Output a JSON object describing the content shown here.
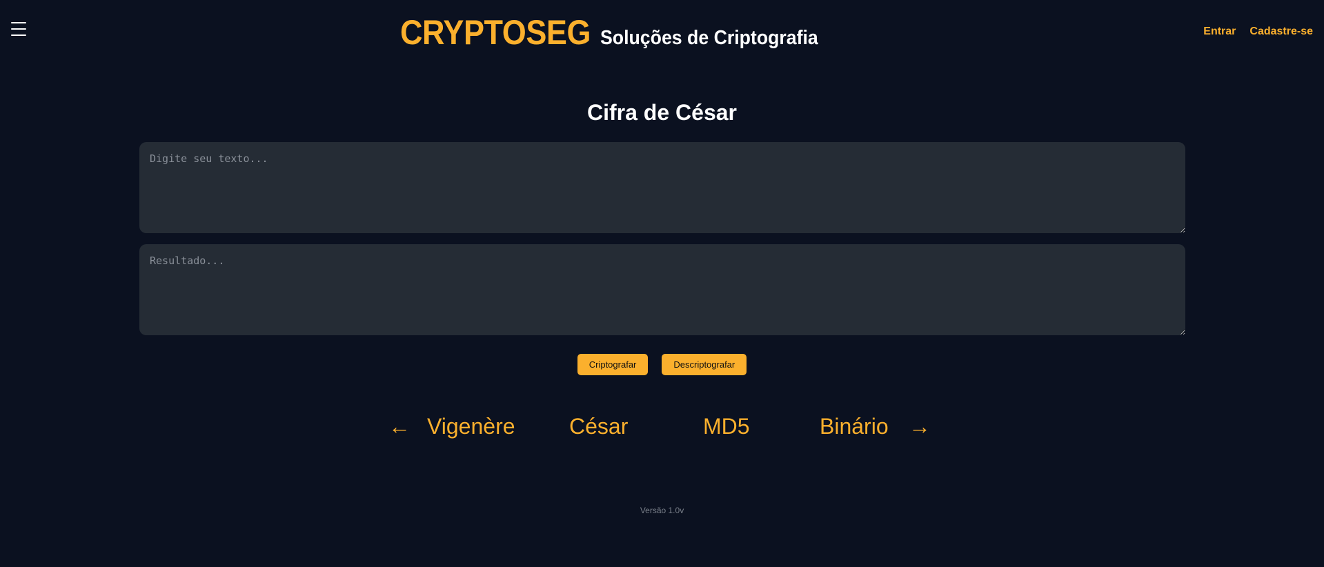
{
  "header": {
    "brand_name": "CRYPTOSEG",
    "tagline": "Soluções de Criptografia",
    "login_label": "Entrar",
    "signup_label": "Cadastre-se"
  },
  "main": {
    "title": "Cifra de César",
    "input_placeholder": "Digite seu texto...",
    "output_placeholder": "Resultado...",
    "encrypt_label": "Criptografar",
    "decrypt_label": "Descriptografar"
  },
  "nav": {
    "prev_arrow": "←",
    "next_arrow": "→",
    "items": [
      "Vigenère",
      "César",
      "MD5",
      "Binário"
    ]
  },
  "footer": {
    "version": "Versão 1.0v"
  },
  "colors": {
    "background": "#0b1120",
    "accent": "#fbb02d",
    "textarea_bg": "#252c35"
  },
  "icons": {
    "menu": "hamburger-menu-icon",
    "prev": "arrow-left-icon",
    "next": "arrow-right-icon"
  }
}
